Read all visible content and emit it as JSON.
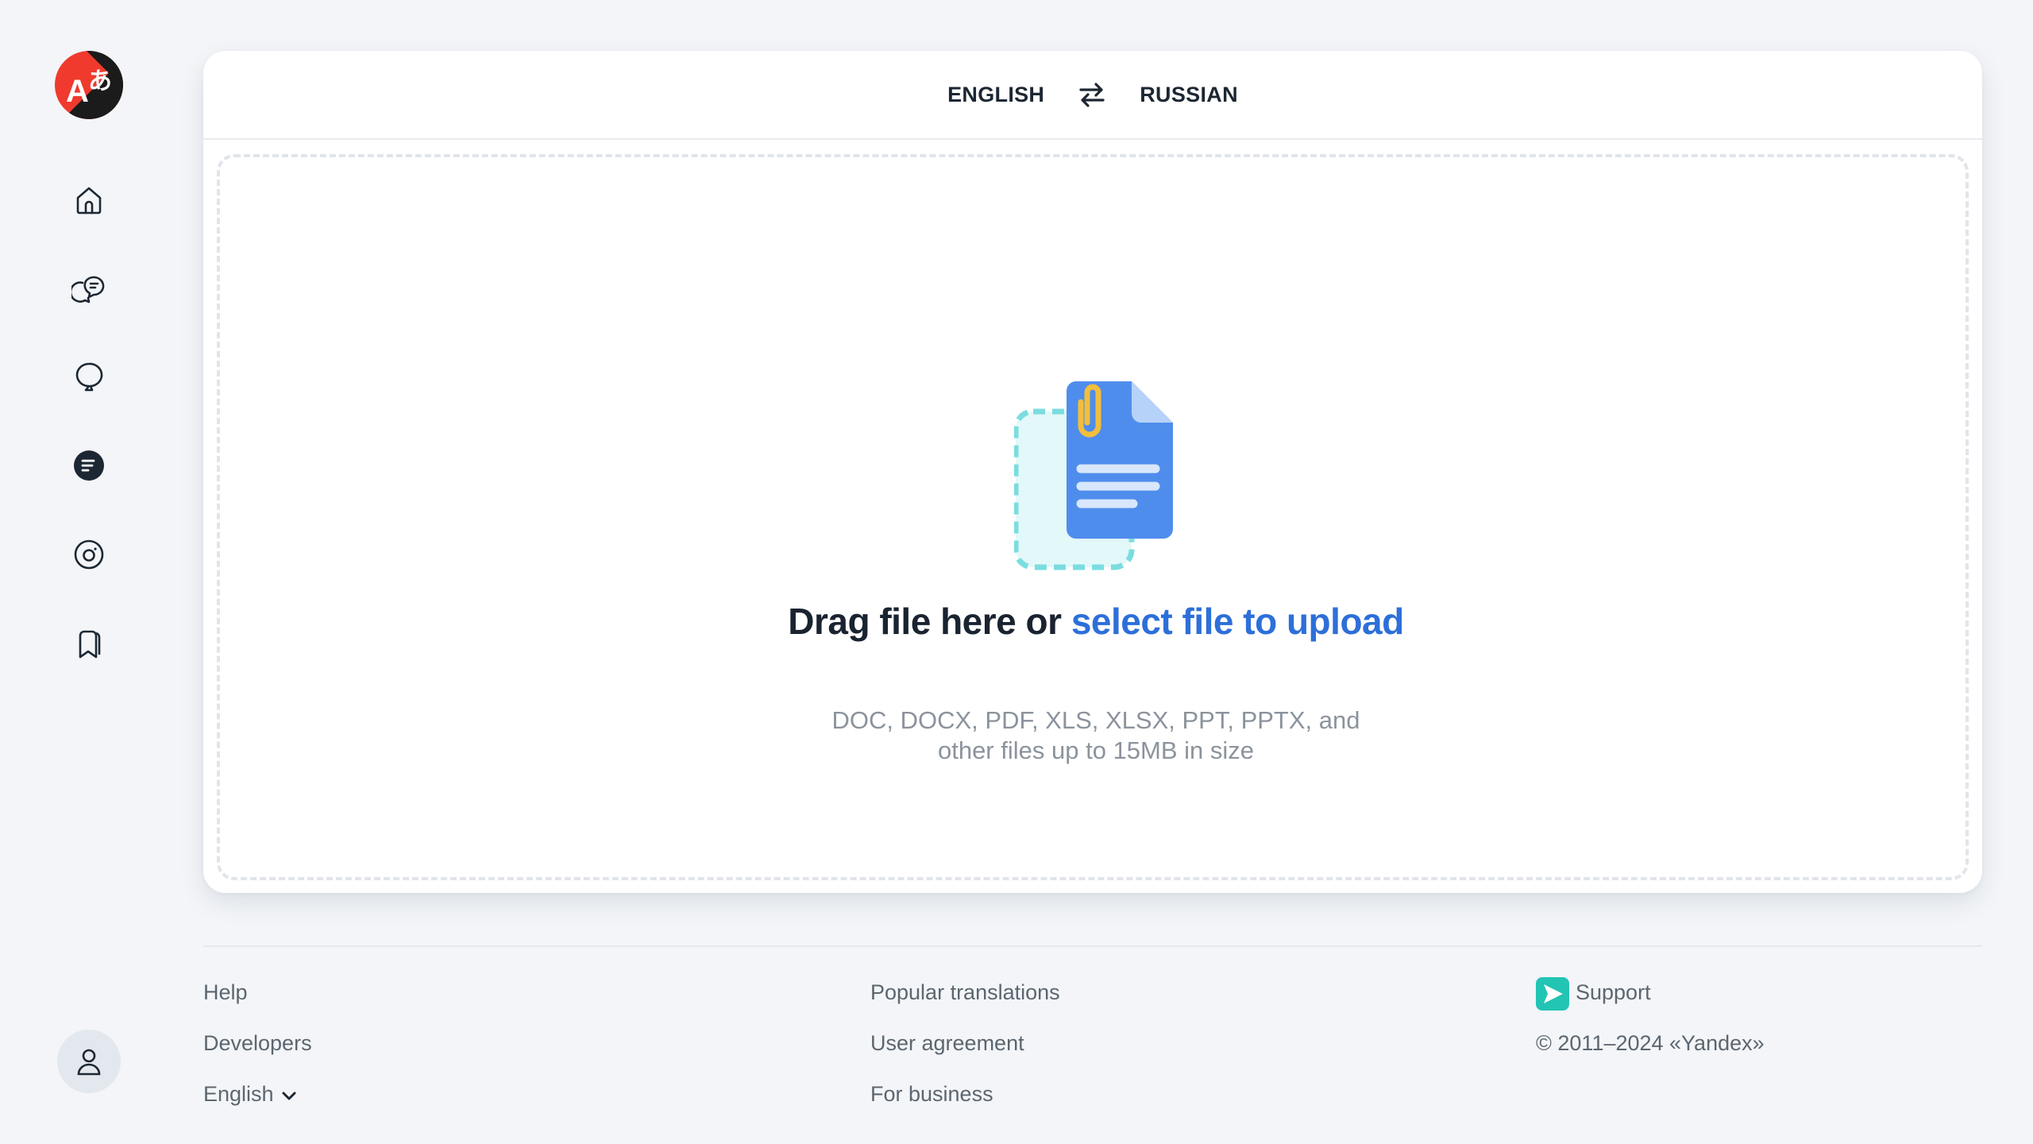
{
  "sidebar": {
    "logo_icon": "translate-logo-icon",
    "items": [
      {
        "name": "home",
        "icon": "home-icon"
      },
      {
        "name": "chat",
        "icon": "chat-bubbles-icon"
      },
      {
        "name": "speech",
        "icon": "speech-bubble-icon"
      },
      {
        "name": "documents",
        "icon": "document-icon",
        "active": true
      },
      {
        "name": "images",
        "icon": "camera-icon"
      },
      {
        "name": "collections",
        "icon": "bookmarks-icon"
      }
    ],
    "profile_icon": "user-icon"
  },
  "lang_bar": {
    "source": "ENGLISH",
    "target": "RUSSIAN",
    "swap_icon": "swap-arrows-icon"
  },
  "dropzone": {
    "title_prefix": "Drag file here or ",
    "title_link": "select file to upload",
    "subtitle_line1": "DOC, DOCX, PDF, XLS, XLSX, PPT, PPTX, and",
    "subtitle_line2": "other files up to 15MB in size",
    "illustration_icon": "file-with-paperclip-icon"
  },
  "footer": {
    "col1": {
      "help": "Help",
      "developers": "Developers",
      "language": "English"
    },
    "col2": {
      "popular": "Popular translations",
      "agreement": "User agreement",
      "business": "For business"
    },
    "col3": {
      "support": "Support",
      "copyright": "© 2011–2024 «Yandex»"
    }
  },
  "colors": {
    "accent_link": "#2d6fd9",
    "background": "#f3f5f8",
    "logo_red": "#f03a2e",
    "support_teal": "#22c4b4"
  }
}
